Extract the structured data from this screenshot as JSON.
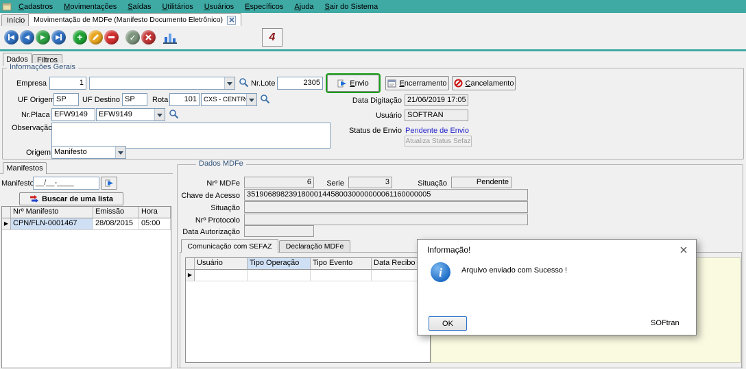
{
  "colors": {
    "menubar_teal": "#3FA9A4",
    "status_blue": "#2222CC",
    "selection_blue": "#CFE0F4",
    "memo_yellow": "#FAFAE1",
    "envio_focus_green": "#18A018"
  },
  "menubar": {
    "items": [
      "Cadastros",
      "Movimentações",
      "Saídas",
      "Utilitários",
      "Usuários",
      "Específicos",
      "Ajuda",
      "Sair do Sistema"
    ]
  },
  "window_tabs": {
    "inicio": "Início",
    "active": "Movimentação de MDFe (Manifesto Documento Eletrônico)"
  },
  "toolbar": {
    "logo_text": "4"
  },
  "page_tabs": {
    "dados": "Dados",
    "filtros": "Filtros"
  },
  "info_gerais": {
    "caption": "Informações Gerais",
    "empresa": {
      "label": "Empresa",
      "code": "1",
      "name": ""
    },
    "nr_lote": {
      "label": "Nr.Lote",
      "value": "2305"
    },
    "buttons": {
      "envio": "Envio",
      "encerramento": "Encerramento",
      "cancelamento": "Cancelamento"
    },
    "uf_origem": {
      "label": "UF Origem",
      "value": "SP"
    },
    "uf_destino": {
      "label": "UF Destino",
      "value": "SP"
    },
    "rota": {
      "label": "Rota",
      "code": "101",
      "name": "CXS - CENTRO"
    },
    "data_digitacao": {
      "label": "Data Digitação",
      "value": "21/06/2019 17:05"
    },
    "nr_placa": {
      "label": "Nr.Placa",
      "value": "EFW9149",
      "combo": "EFW9149"
    },
    "usuario": {
      "label": "Usuário",
      "value": "SOFTRAN"
    },
    "observacao": {
      "label": "Observação",
      "value": ""
    },
    "status_envio": {
      "label": "Status de Envio",
      "value": "Pendente de Envio",
      "button": "Atualiza Status Sefaz"
    },
    "origem": {
      "label": "Origem",
      "value": "Manifesto"
    }
  },
  "manifestos": {
    "tab": "Manifestos",
    "label": "Manifesto",
    "mask": "__/__-____",
    "buscar": "Buscar de uma lista",
    "grid": {
      "columns": [
        "Nrº Manifesto",
        "Emissão",
        "Hora"
      ],
      "rows": [
        {
          "nr": "CPN/FLN-0001467",
          "emissao": "28/08/2015",
          "hora": "05:00"
        }
      ]
    }
  },
  "dados_mdfe": {
    "caption": "Dados MDFe",
    "nr_mdfe": {
      "label": "Nrº MDFe",
      "value": "6"
    },
    "serie": {
      "label": "Serie",
      "value": "3"
    },
    "situacao": {
      "label": "Situação",
      "value": "Pendente"
    },
    "chave_acesso": {
      "label": "Chave de Acesso",
      "value": "35190689823918000144580030000000061160000005"
    },
    "situacao2": {
      "label": "Situação",
      "value": ""
    },
    "protocolo": {
      "label": "Nrº Protocolo",
      "value": ""
    },
    "data_autorizacao": {
      "label": "Data Autorização",
      "value": ""
    },
    "tabs": [
      "Comunicação com SEFAZ",
      "Declaração MDFe"
    ],
    "grid": {
      "columns": [
        "Usuário",
        "Tipo Operação",
        "Tipo Evento",
        "Data Recibo"
      ]
    }
  },
  "dialog": {
    "title": "Informação!",
    "message": "Arquivo enviado com Sucesso !",
    "ok": "OK",
    "brand": "SOFtran"
  }
}
